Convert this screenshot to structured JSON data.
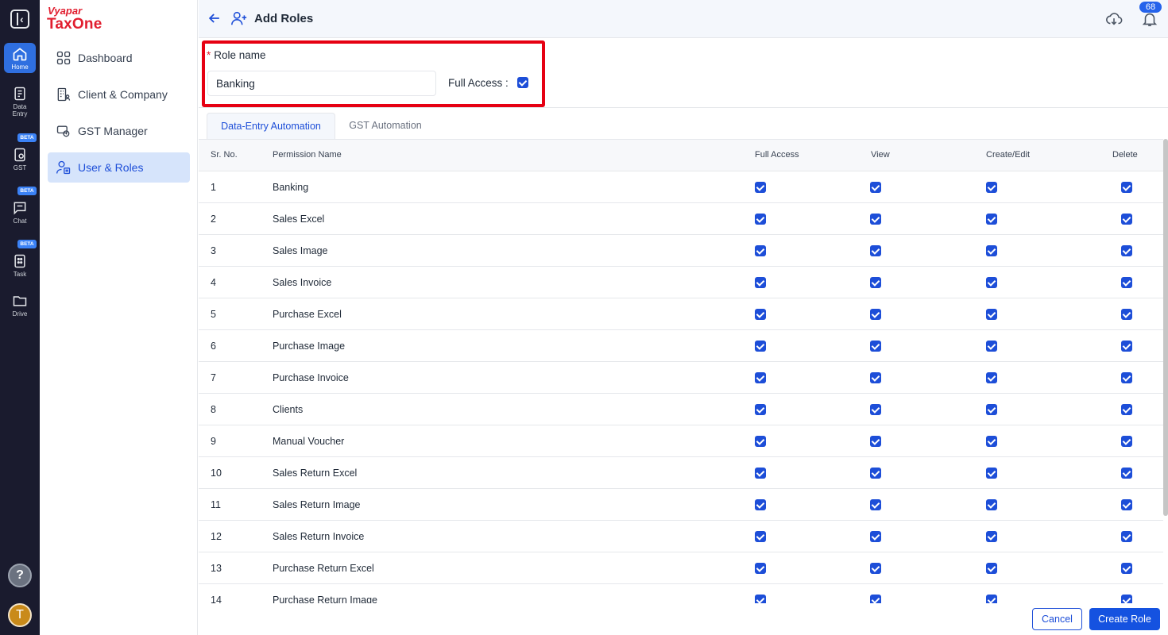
{
  "rail": {
    "items": [
      {
        "label": "Home",
        "icon": "home-icon",
        "active": true
      },
      {
        "label": "Data\nEntry",
        "icon": "data-entry-icon"
      },
      {
        "label": "GST",
        "icon": "gst-icon",
        "badge": "BETA"
      },
      {
        "label": "Chat",
        "icon": "chat-icon",
        "badge": "BETA"
      },
      {
        "label": "Task",
        "icon": "task-icon",
        "badge": "BETA"
      },
      {
        "label": "Drive",
        "icon": "drive-icon"
      }
    ],
    "help": "?",
    "avatar": "T"
  },
  "brand": {
    "top": "Vyapar",
    "bottom": "TaxOne"
  },
  "sidebar": {
    "items": [
      {
        "label": "Dashboard",
        "icon": "dashboard-icon"
      },
      {
        "label": "Client & Company",
        "icon": "client-company-icon"
      },
      {
        "label": "GST Manager",
        "icon": "gst-manager-icon"
      },
      {
        "label": "User & Roles",
        "icon": "user-roles-icon",
        "active": true
      }
    ]
  },
  "header": {
    "title": "Add Roles",
    "notification_count": "68"
  },
  "form": {
    "role_label": "Role name",
    "required_mark": "*",
    "role_value": "Banking",
    "full_access_label": "Full Access :",
    "full_access_checked": true
  },
  "tabs": [
    {
      "label": "Data-Entry Automation",
      "active": true
    },
    {
      "label": "GST Automation",
      "active": false
    }
  ],
  "table": {
    "columns": [
      "Sr. No.",
      "Permission Name",
      "Full Access",
      "View",
      "Create/Edit",
      "Delete"
    ],
    "rows": [
      {
        "sr": "1",
        "name": "Banking"
      },
      {
        "sr": "2",
        "name": "Sales Excel"
      },
      {
        "sr": "3",
        "name": "Sales Image"
      },
      {
        "sr": "4",
        "name": "Sales Invoice"
      },
      {
        "sr": "5",
        "name": "Purchase Excel"
      },
      {
        "sr": "6",
        "name": "Purchase Image"
      },
      {
        "sr": "7",
        "name": "Purchase Invoice"
      },
      {
        "sr": "8",
        "name": "Clients"
      },
      {
        "sr": "9",
        "name": "Manual Voucher"
      },
      {
        "sr": "10",
        "name": "Sales Return Excel"
      },
      {
        "sr": "11",
        "name": "Sales Return Image"
      },
      {
        "sr": "12",
        "name": "Sales Return Invoice"
      },
      {
        "sr": "13",
        "name": "Purchase Return Excel"
      },
      {
        "sr": "14",
        "name": "Purchase Return Image"
      }
    ]
  },
  "footer": {
    "cancel": "Cancel",
    "create": "Create Role"
  },
  "colors": {
    "accent": "#1d4ed8",
    "brand": "#e11d2e",
    "highlight": "#e60012",
    "rail": "#1a1b2e"
  }
}
